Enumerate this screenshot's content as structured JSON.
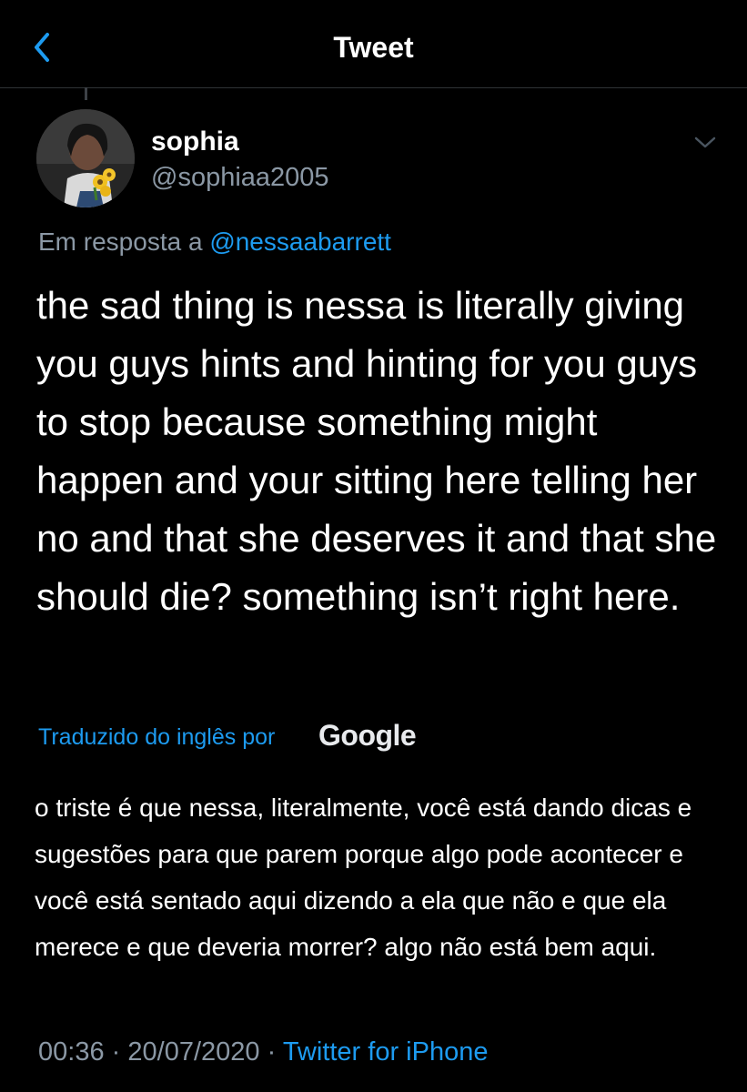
{
  "header": {
    "title": "Tweet"
  },
  "author": {
    "display_name": "sophia",
    "handle": "@sophiaa2005"
  },
  "reply": {
    "prefix": "Em resposta a",
    "mention": "@nessaabarrett"
  },
  "tweet": {
    "text": "the sad thing is nessa is literally giving you guys hints and hinting for you guys to stop because something might happen and your sitting here telling her no and that she deserves it and that she should die? something isn’t right here."
  },
  "translation": {
    "label": "Traduzido do inglês por",
    "provider": "Google",
    "text": "o triste é que nessa, literalmente, você está dando dicas e sugestões para que parem porque algo pode acontecer e você está sentado aqui dizendo a ela que não e que ela merece e que deveria morrer? algo não está bem aqui."
  },
  "meta": {
    "time": "00:36",
    "separator": "·",
    "date": "20/07/2020",
    "source": "Twitter for iPhone"
  },
  "colors": {
    "background": "#000000",
    "accent": "#1d9bf0",
    "muted": "#8b98a5"
  },
  "icons": {
    "back": "chevron-left-icon",
    "menu": "chevron-down-icon"
  }
}
